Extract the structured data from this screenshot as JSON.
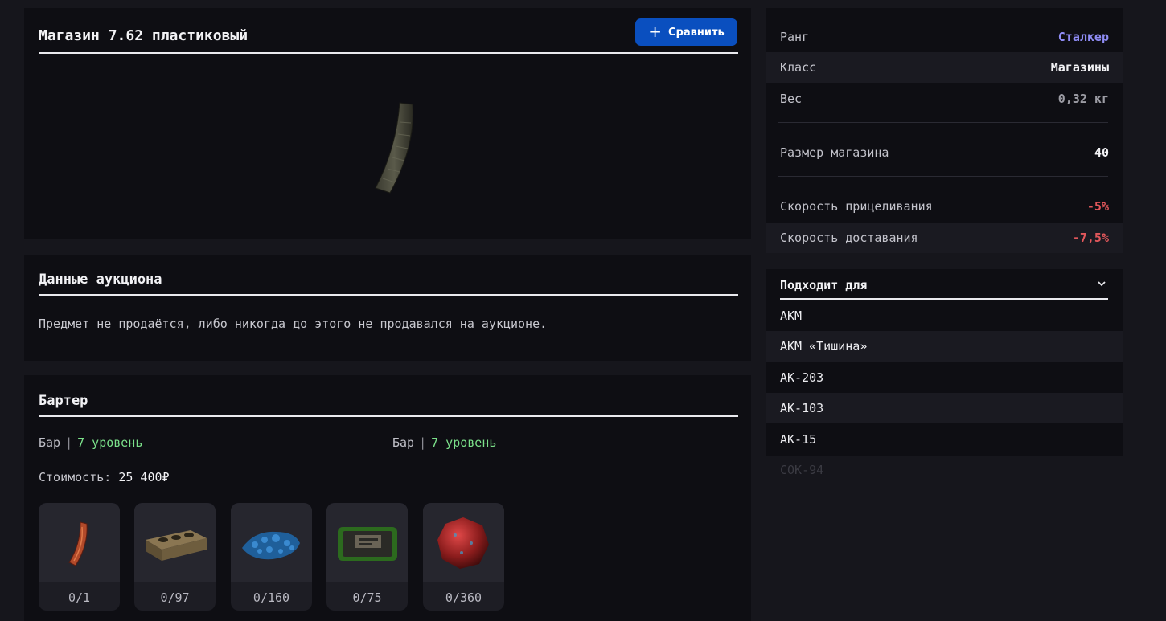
{
  "item": {
    "title": "Магазин 7.62 пластиковый",
    "compare_label": "Сравнить"
  },
  "auction": {
    "title": "Данные аукциона",
    "text": "Предмет не продаётся, либо никогда до этого не продавался на аукционе."
  },
  "barter": {
    "title": "Бартер",
    "offers": [
      {
        "place": "Бар",
        "level": "7 уровень"
      },
      {
        "place": "Бар",
        "level": "7 уровень"
      }
    ],
    "cost_label": "Стоимость:",
    "cost_value": "25 400₽",
    "items": [
      {
        "icon": "orange-magazine-icon",
        "qty": "0/1"
      },
      {
        "icon": "brick-block-icon",
        "qty": "0/97"
      },
      {
        "icon": "blue-crystals-icon",
        "qty": "0/160"
      },
      {
        "icon": "green-device-icon",
        "qty": "0/75"
      },
      {
        "icon": "red-artifact-icon",
        "qty": "0/360"
      }
    ]
  },
  "stats": [
    {
      "label": "Ранг",
      "value": "Сталкер",
      "color": "#8f8cf5"
    },
    {
      "label": "Класс",
      "value": "Магазины",
      "color": "#f2f2f5"
    },
    {
      "label": "Вес",
      "value": "0,32 кг",
      "color": "#9c9ca4"
    },
    {
      "label": "Размер магазина",
      "value": "40",
      "color": "#f2f2f5"
    },
    {
      "label": "Скорость прицеливания",
      "value": "-5%",
      "color": "#e2575b"
    },
    {
      "label": "Скорость доставания",
      "value": "-7,5%",
      "color": "#e2575b"
    }
  ],
  "fits": {
    "title": "Подходит для",
    "items": [
      "АКМ",
      "АКМ «Тишина»",
      "АК-203",
      "АК-103",
      "АК-15",
      "СОК-94"
    ]
  },
  "colors": {
    "accent_blue": "#0a4fbf",
    "level_green": "#7be08a",
    "negative_red": "#e2575b",
    "rank_purple": "#8f8cf5"
  }
}
